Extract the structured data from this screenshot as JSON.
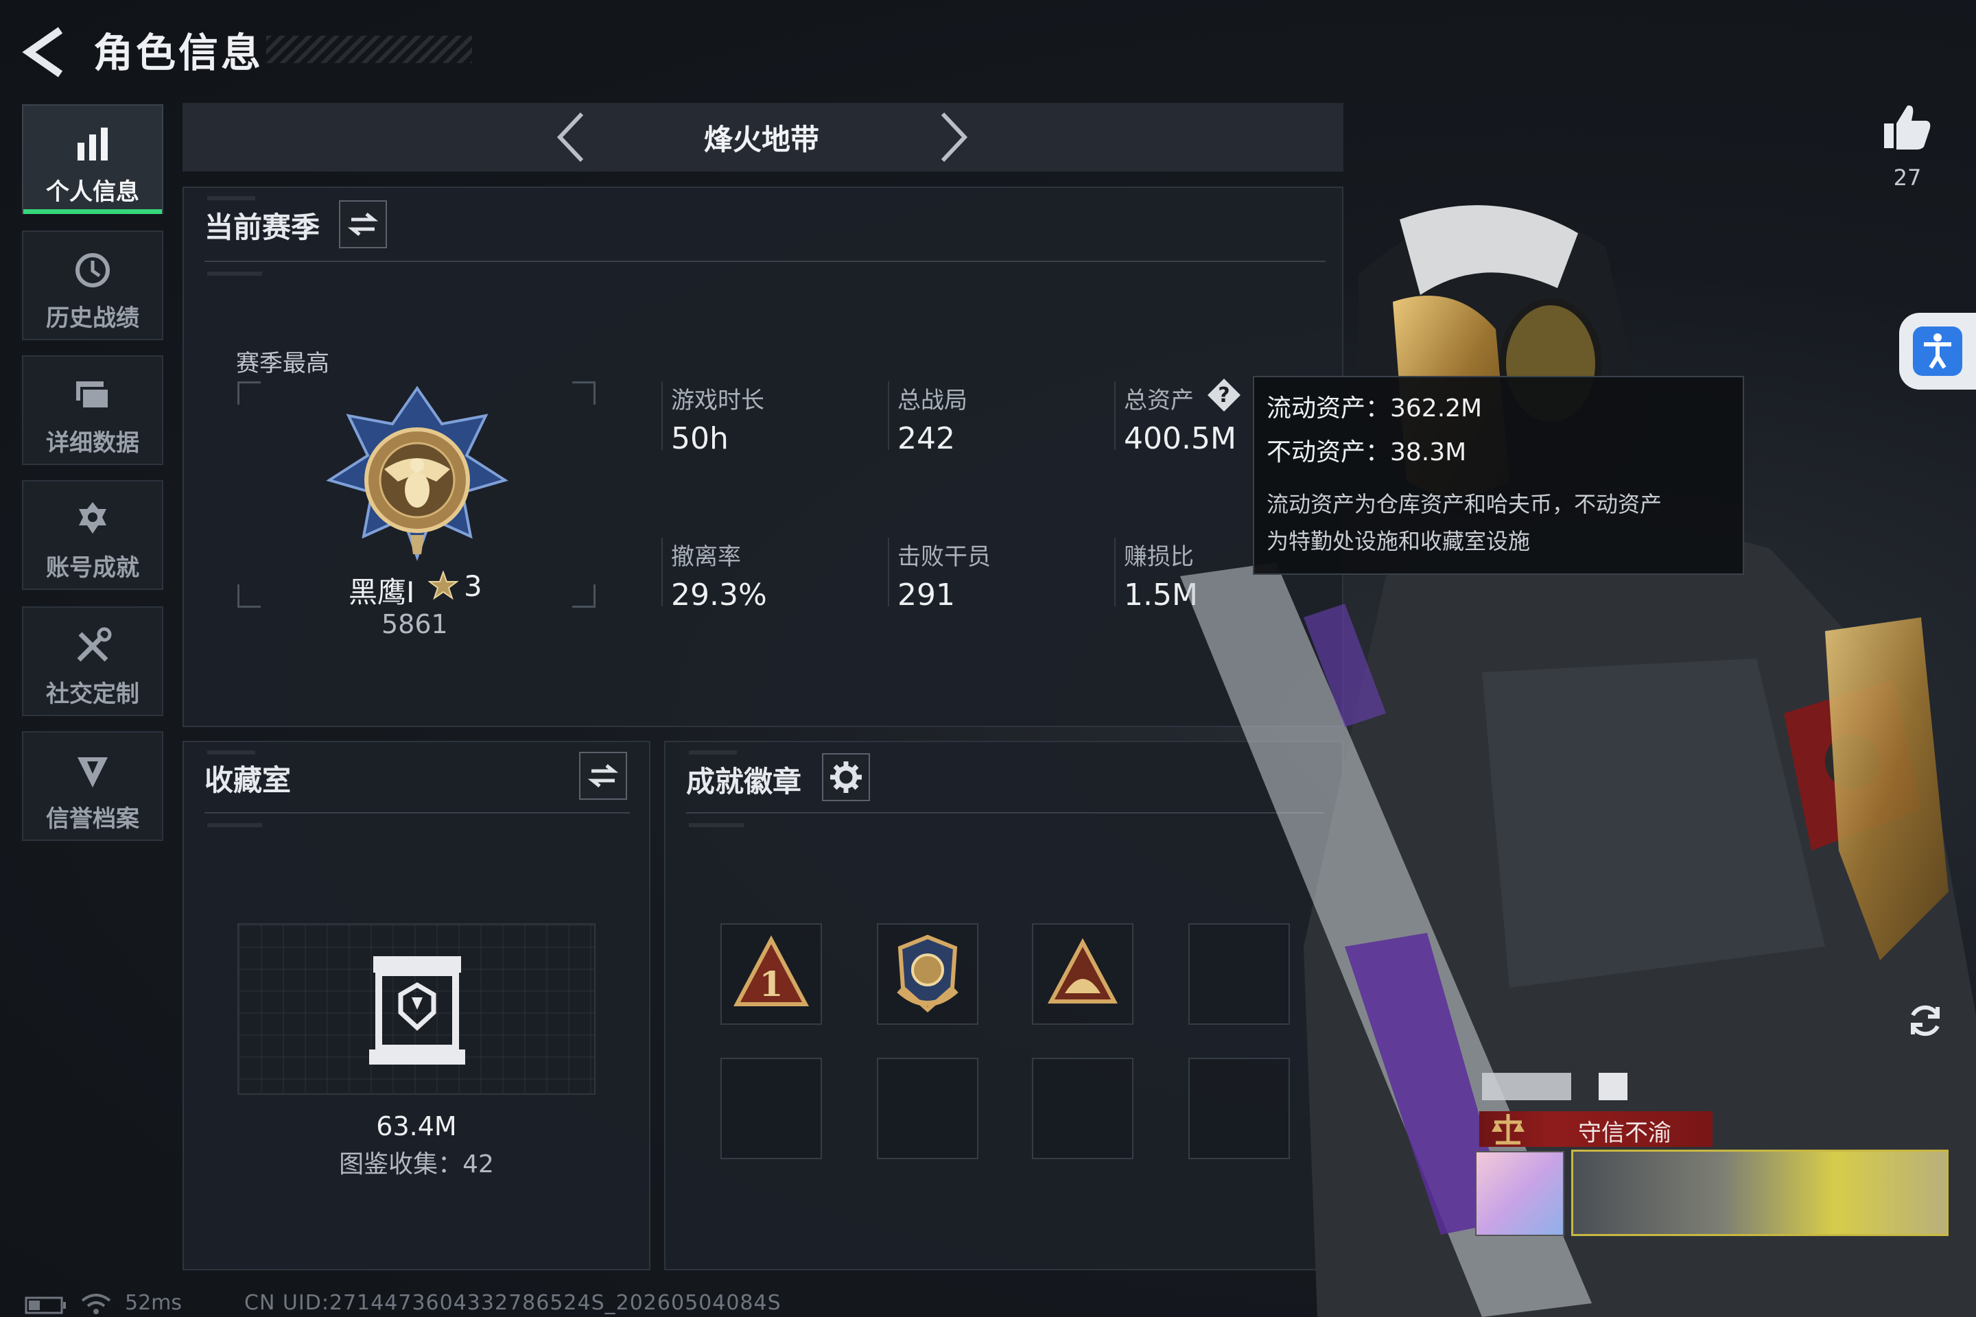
{
  "header": {
    "title": "角色信息"
  },
  "sidebar": {
    "items": [
      {
        "label": "个人信息",
        "icon": "bar-chart-icon",
        "active": true
      },
      {
        "label": "历史战绩",
        "icon": "history-clock-icon"
      },
      {
        "label": "详细数据",
        "icon": "folder-stack-icon"
      },
      {
        "label": "账号成就",
        "icon": "achievement-star-icon"
      },
      {
        "label": "社交定制",
        "icon": "tools-wrench-icon"
      },
      {
        "label": "信誉档案",
        "icon": "shield-emblem-icon"
      }
    ]
  },
  "mode": {
    "name": "烽火地带"
  },
  "season": {
    "title": "当前赛季",
    "best_label": "赛季最高",
    "rank_name": "黑鹰I",
    "rank_stars": "3",
    "rank_score": "5861",
    "stats": {
      "play_time": {
        "label": "游戏时长",
        "value": "50h"
      },
      "total_matches": {
        "label": "总战局",
        "value": "242"
      },
      "total_assets": {
        "label": "总资产",
        "value": "400.5M"
      },
      "extract_rate": {
        "label": "撤离率",
        "value": "29.3%"
      },
      "kills": {
        "label": "击败干员",
        "value": "291"
      },
      "profit_ratio": {
        "label": "赚损比",
        "value": "1.5M"
      }
    }
  },
  "tooltip": {
    "liquid": "流动资产：362.2M",
    "fixed": "不动资产：38.3M",
    "note_line1": "流动资产为仓库资产和哈夫币，不动资产",
    "note_line2": "为特勤处设施和收藏室设施"
  },
  "collection": {
    "title": "收藏室",
    "value": "63.4M",
    "collected": "图鉴收集：42"
  },
  "badges": {
    "title": "成就徽章",
    "items": [
      "rank-one-badge-icon",
      "shield-wings-badge-icon",
      "dome-triangle-badge-icon"
    ]
  },
  "likes": {
    "count": "27"
  },
  "honor": {
    "label": "守信不渝"
  },
  "footer": {
    "latency": "52ms",
    "uid": "CN UID:2714473604332786524S_20260504084S"
  },
  "colors": {
    "accent_green": "#36d67a",
    "honor_red": "#8f1c1c",
    "access_blue": "#2f7be6"
  }
}
